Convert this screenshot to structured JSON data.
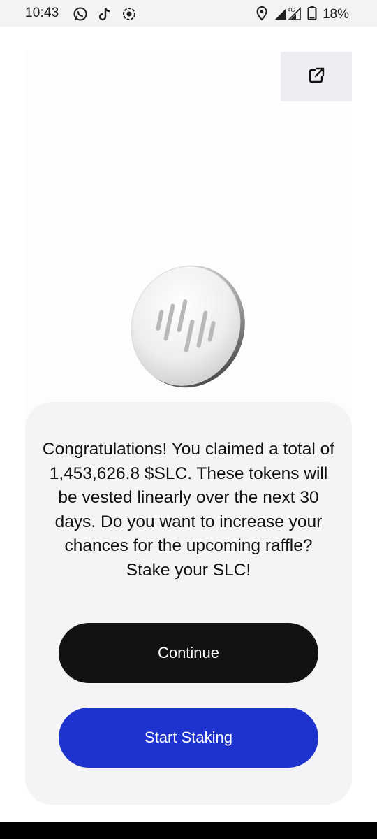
{
  "status_bar": {
    "time": "10:43",
    "left_icons": [
      "whatsapp-icon",
      "tiktok-icon",
      "screen-record-icon"
    ],
    "right_icons": [
      "location-icon",
      "signal-icon",
      "network-4g-icon",
      "battery-icon"
    ],
    "network_type": "4G",
    "battery_percent": "18%"
  },
  "hero": {
    "external_link_icon": "open-external-icon",
    "coin_icon": "slc-coin-icon"
  },
  "card": {
    "message": "Congratulations! You claimed a total of 1,453,626.8 $SLC. These tokens will be vested linearly over the next 30 days. Do you want to increase your chances for the upcoming raffle? Stake your SLC!",
    "continue_label": "Continue",
    "stake_label": "Start Staking"
  },
  "colors": {
    "continue_button": "#111214",
    "stake_button": "#1e33cd",
    "card_background": "#f4f4f6"
  }
}
